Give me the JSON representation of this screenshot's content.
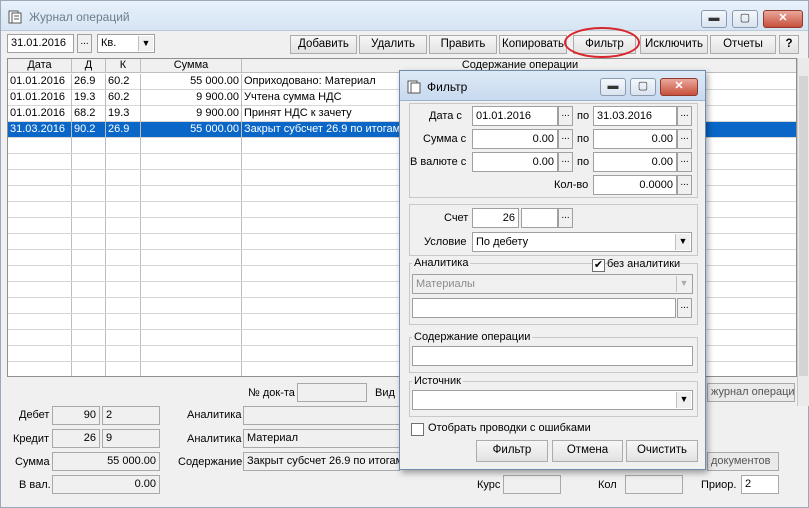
{
  "window": {
    "title": "Журнал операций",
    "min_glyph": "▬",
    "max_glyph": "▢",
    "close_glyph": "✕"
  },
  "toolbar": {
    "date": "31.01.2016",
    "period": "Кв.",
    "ellipsis": "...",
    "buttons": [
      "Добавить",
      "Удалить",
      "Править",
      "Копировать",
      "Фильтр",
      "Исключить",
      "Отчеты",
      "?"
    ]
  },
  "table": {
    "headers": [
      "Дата",
      "Д",
      "К",
      "Сумма",
      "Содержание операции"
    ],
    "rows": [
      [
        "01.01.2016",
        "26.9",
        "60.2",
        "55 000.00",
        "Оприходовано: Материал"
      ],
      [
        "01.01.2016",
        "19.3",
        "60.2",
        "9 900.00",
        "Учтена сумма НДС"
      ],
      [
        "01.01.2016",
        "68.2",
        "19.3",
        "9 900.00",
        "Принят НДС к зачету"
      ],
      [
        "31.03.2016",
        "90.2",
        "26.9",
        "55 000.00",
        "Закрыт субсчет 26.9 по итогам"
      ]
    ]
  },
  "bottom": {
    "doc_no_label": "№ док-та",
    "vid_label": "Вид",
    "journal_btn": "журнал операций)",
    "debit_label": "Дебет",
    "debit_acc": "90",
    "debit_sub": "2",
    "credit_label": "Кредит",
    "credit_acc": "26",
    "credit_sub": "9",
    "sum_label": "Сумма",
    "sum_value": "55 000.00",
    "val_label": "В вал.",
    "val_value": "0.00",
    "analytics_label": "Аналитика",
    "analytics2_label": "Аналитика",
    "analytics2_value": "Материал",
    "content_label": "Содержание",
    "content_value": "Закрыт субсчет 26.9 по итогам",
    "docs_btn": "документов",
    "kurs_label": "Курс",
    "kol_label": "Кол",
    "prior_label": "Приор.",
    "prior_value": "2"
  },
  "dialog": {
    "title": "Фильтр",
    "date_from_label": "Дата с",
    "date_from": "01.01.2016",
    "date_to_label": "по",
    "date_to": "31.03.2016",
    "sum_from_label": "Сумма с",
    "sum_from": "0.00",
    "sum_to_label": "по",
    "sum_to": "0.00",
    "val_from_label": "В валюте с",
    "val_from": "0.00",
    "val_to_label": "по",
    "val_to": "0.00",
    "qty_label": "Кол-во",
    "qty": "0.0000",
    "account_label": "Счет",
    "account": "26",
    "condition_label": "Условие",
    "condition": "По дебету",
    "analytics_label": "Аналитика",
    "no_analytics_label": "без аналитики",
    "no_analytics_checked": "✔",
    "analytics_value": "Материалы",
    "content_label": "Содержание операции",
    "source_label": "Источник",
    "errors_label": "Отобрать проводки с ошибками",
    "btn_filter": "Фильтр",
    "btn_cancel": "Отмена",
    "btn_clear": "Очистить"
  },
  "colors": {
    "selection": "#0a67c7",
    "highlight_oval": "#d9262c",
    "close_button": "#c8503c"
  }
}
